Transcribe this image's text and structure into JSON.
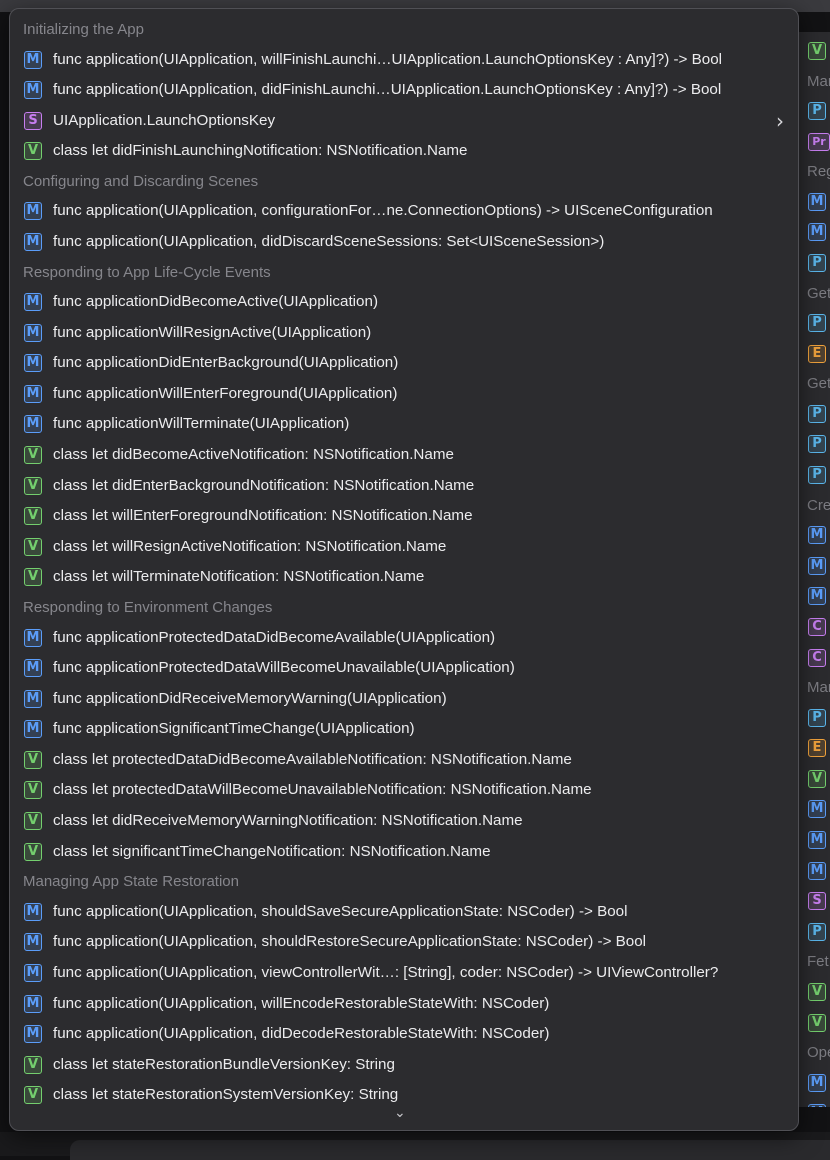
{
  "sections": [
    {
      "title": "Initializing the App",
      "items": [
        {
          "kind": "M",
          "text": "func application(UIApplication, willFinishLaunchi…UIApplication.LaunchOptionsKey : Any]?) -> Bool"
        },
        {
          "kind": "M",
          "text": "func application(UIApplication, didFinishLaunchi…UIApplication.LaunchOptionsKey : Any]?) -> Bool"
        },
        {
          "kind": "S",
          "text": "UIApplication.LaunchOptionsKey",
          "has_submenu": true
        },
        {
          "kind": "V",
          "text": "class let didFinishLaunchingNotification: NSNotification.Name"
        }
      ]
    },
    {
      "title": "Configuring and Discarding Scenes",
      "items": [
        {
          "kind": "M",
          "text": "func application(UIApplication, configurationFor…ne.ConnectionOptions) -> UISceneConfiguration"
        },
        {
          "kind": "M",
          "text": "func application(UIApplication, didDiscardSceneSessions: Set<UISceneSession>)"
        }
      ]
    },
    {
      "title": "Responding to App Life-Cycle Events",
      "items": [
        {
          "kind": "M",
          "text": "func applicationDidBecomeActive(UIApplication)"
        },
        {
          "kind": "M",
          "text": "func applicationWillResignActive(UIApplication)"
        },
        {
          "kind": "M",
          "text": "func applicationDidEnterBackground(UIApplication)"
        },
        {
          "kind": "M",
          "text": "func applicationWillEnterForeground(UIApplication)"
        },
        {
          "kind": "M",
          "text": "func applicationWillTerminate(UIApplication)"
        },
        {
          "kind": "V",
          "text": "class let didBecomeActiveNotification: NSNotification.Name"
        },
        {
          "kind": "V",
          "text": "class let didEnterBackgroundNotification: NSNotification.Name"
        },
        {
          "kind": "V",
          "text": "class let willEnterForegroundNotification: NSNotification.Name"
        },
        {
          "kind": "V",
          "text": "class let willResignActiveNotification: NSNotification.Name"
        },
        {
          "kind": "V",
          "text": "class let willTerminateNotification: NSNotification.Name"
        }
      ]
    },
    {
      "title": "Responding to Environment Changes",
      "items": [
        {
          "kind": "M",
          "text": "func applicationProtectedDataDidBecomeAvailable(UIApplication)"
        },
        {
          "kind": "M",
          "text": "func applicationProtectedDataWillBecomeUnavailable(UIApplication)"
        },
        {
          "kind": "M",
          "text": "func applicationDidReceiveMemoryWarning(UIApplication)"
        },
        {
          "kind": "M",
          "text": "func applicationSignificantTimeChange(UIApplication)"
        },
        {
          "kind": "V",
          "text": "class let protectedDataDidBecomeAvailableNotification: NSNotification.Name"
        },
        {
          "kind": "V",
          "text": "class let protectedDataWillBecomeUnavailableNotification: NSNotification.Name"
        },
        {
          "kind": "V",
          "text": "class let didReceiveMemoryWarningNotification: NSNotification.Name"
        },
        {
          "kind": "V",
          "text": "class let significantTimeChangeNotification: NSNotification.Name"
        }
      ]
    },
    {
      "title": "Managing App State Restoration",
      "items": [
        {
          "kind": "M",
          "text": "func application(UIApplication, shouldSaveSecureApplicationState: NSCoder) -> Bool"
        },
        {
          "kind": "M",
          "text": "func application(UIApplication, shouldRestoreSecureApplicationState: NSCoder) -> Bool"
        },
        {
          "kind": "M",
          "text": "func application(UIApplication, viewControllerWit…: [String], coder: NSCoder) -> UIViewController?"
        },
        {
          "kind": "M",
          "text": "func application(UIApplication, willEncodeRestorableStateWith: NSCoder)"
        },
        {
          "kind": "M",
          "text": "func application(UIApplication, didDecodeRestorableStateWith: NSCoder)"
        },
        {
          "kind": "V",
          "text": "class let stateRestorationBundleVersionKey: String"
        },
        {
          "kind": "V",
          "text": "class let stateRestorationSystemVersionKey: String"
        }
      ]
    }
  ],
  "submenu_icon": "chevron-right-icon",
  "more_icon": "chevron-down-icon",
  "right_panel": {
    "headers": [
      "Mar",
      "Reg",
      "Get",
      "Get",
      "Cre",
      "Mar",
      "Fet",
      "Ope"
    ],
    "badges": [
      "V",
      "P",
      "Pr",
      "M",
      "M",
      "P",
      "P",
      "E",
      "P",
      "P",
      "P",
      "M",
      "M",
      "M",
      "C",
      "C",
      "P",
      "E",
      "V",
      "M",
      "M",
      "M",
      "S",
      "P",
      "V",
      "V",
      "M",
      "M"
    ]
  },
  "colors": {
    "method": "#5b9df9",
    "variable": "#74cf6e",
    "struct": "#c77ef0",
    "property": "#5bb7ec",
    "enum": "#f0a23c",
    "popup_bg": "#2c2c2f",
    "header_text": "#86868c",
    "item_text": "#ececee"
  }
}
